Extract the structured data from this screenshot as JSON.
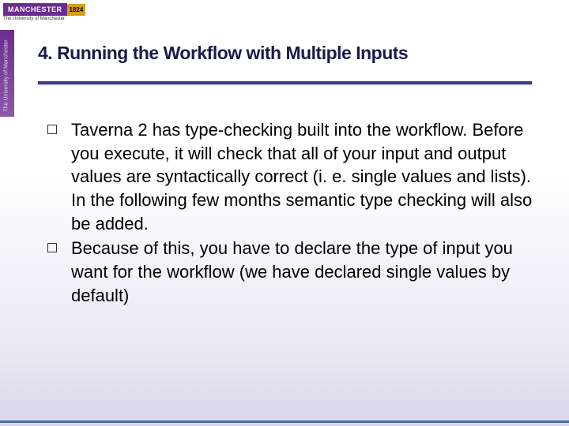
{
  "logo": {
    "name": "MANCHESTER",
    "year": "1824",
    "sub": "The University of Manchester"
  },
  "title": "4. Running the Workflow with Multiple Inputs",
  "bullets": [
    "Taverna 2 has type-checking built into the workflow. Before you execute, it will check that all of your input and output values are syntactically correct (i. e. single values and lists). In the following few months semantic type checking will also be added.",
    "Because of this, you have to declare the type of input you want for the workflow (we have declared single values by default)"
  ]
}
